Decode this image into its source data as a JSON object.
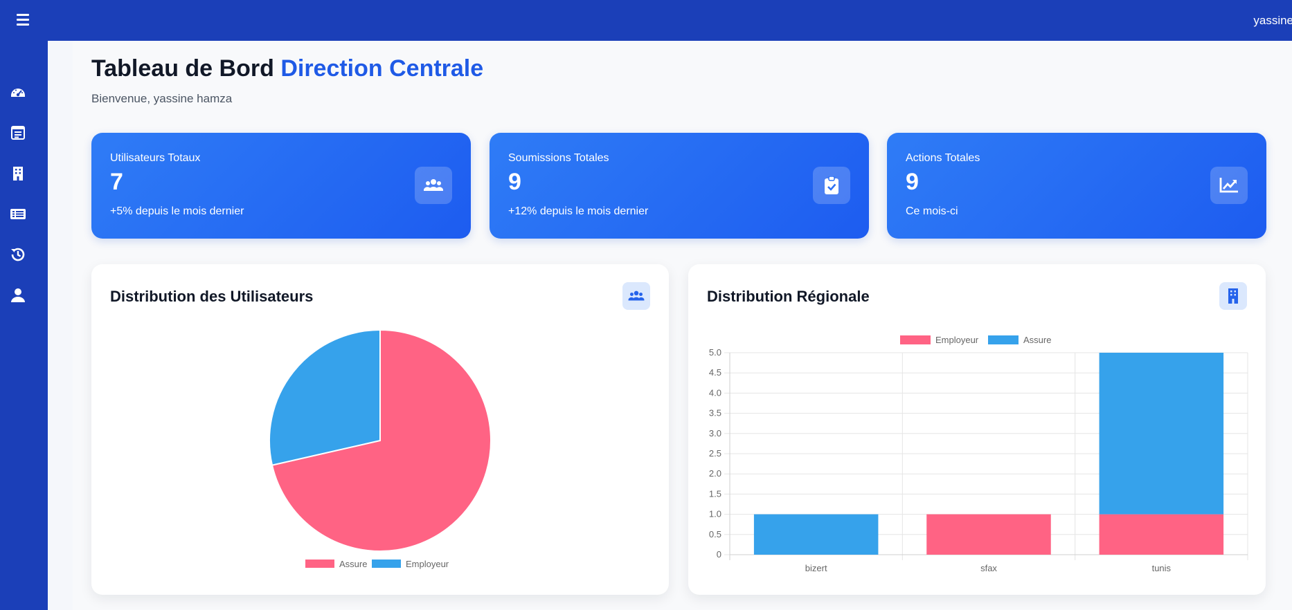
{
  "topbar": {
    "username": "yassine"
  },
  "sidebar": {
    "items": [
      {
        "icon": "dashboard-gauge-icon"
      },
      {
        "icon": "list-document-icon"
      },
      {
        "icon": "building-icon"
      },
      {
        "icon": "table-list-icon"
      },
      {
        "icon": "history-icon"
      },
      {
        "icon": "user-icon"
      }
    ]
  },
  "header": {
    "title_main": "Tableau de Bord",
    "title_accent": "Direction Centrale",
    "welcome": "Bienvenue, yassine hamza"
  },
  "stats": [
    {
      "label": "Utilisateurs Totaux",
      "value": "7",
      "sub": "+5% depuis le mois dernier",
      "icon": "users-icon"
    },
    {
      "label": "Soumissions Totales",
      "value": "9",
      "sub": "+12% depuis le mois dernier",
      "icon": "clipboard-check-icon"
    },
    {
      "label": "Actions Totales",
      "value": "9",
      "sub": "Ce mois-ci",
      "icon": "chart-line-icon"
    }
  ],
  "colors": {
    "primary": "#1b3fb8",
    "accent": "#1f5ae6",
    "pink": "#ff6384",
    "blue": "#36a2eb"
  },
  "charts": {
    "users": {
      "title": "Distribution des Utilisateurs",
      "icon": "users-icon"
    },
    "regional": {
      "title": "Distribution Régionale",
      "icon": "building-icon"
    }
  },
  "chart_data": [
    {
      "type": "pie",
      "title": "Distribution des Utilisateurs",
      "labels": [
        "Assure",
        "Employeur"
      ],
      "values": [
        5,
        2
      ],
      "colors": [
        "#ff6384",
        "#36a2eb"
      ],
      "legend": "bottom"
    },
    {
      "type": "bar",
      "stacked": true,
      "title": "Distribution Régionale",
      "categories": [
        "bizert",
        "sfax",
        "tunis"
      ],
      "series": [
        {
          "name": "Employeur",
          "values": [
            0,
            1,
            1
          ],
          "color": "#ff6384"
        },
        {
          "name": "Assure",
          "values": [
            1,
            0,
            4
          ],
          "color": "#36a2eb"
        }
      ],
      "ylim": [
        0,
        5
      ],
      "yticks": [
        "0",
        "0.5",
        "1.0",
        "1.5",
        "2.0",
        "2.5",
        "3.0",
        "3.5",
        "4.0",
        "4.5",
        "5.0"
      ],
      "grid": true,
      "legend": "top"
    }
  ]
}
